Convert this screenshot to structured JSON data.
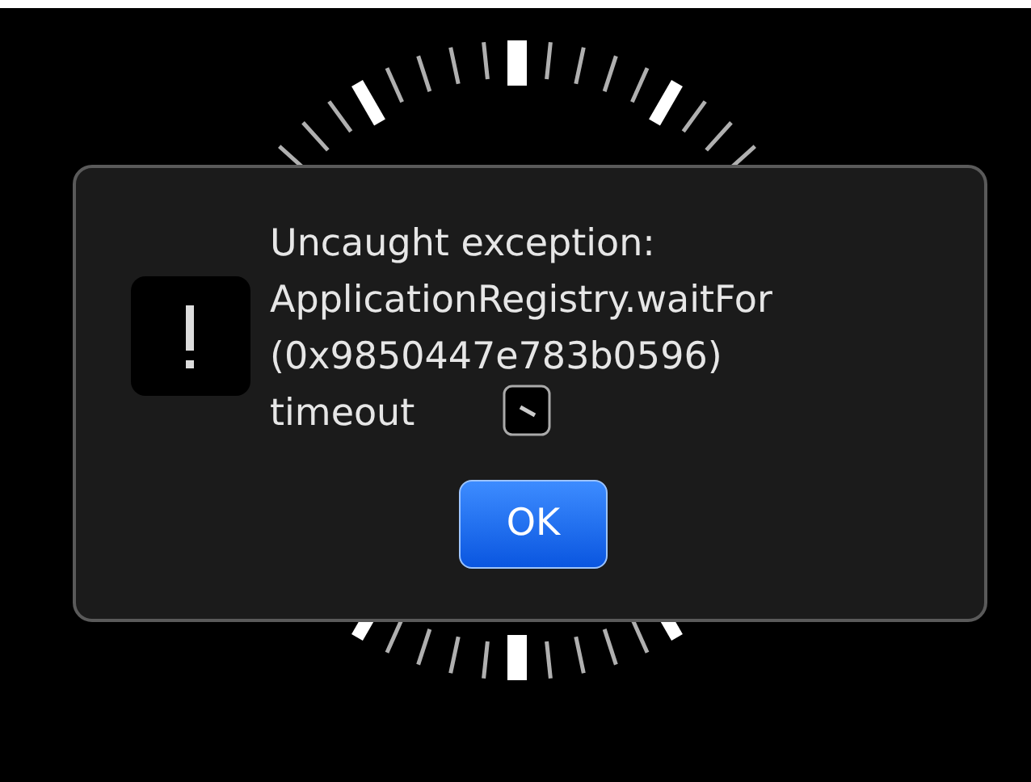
{
  "dialog": {
    "message_lines": [
      "Uncaught exception:",
      "ApplicationRegistry.waitFor",
      "(0x9850447e783b0596)",
      "timeout"
    ],
    "buttons": [
      {
        "label": "OK",
        "selected": true
      }
    ]
  }
}
